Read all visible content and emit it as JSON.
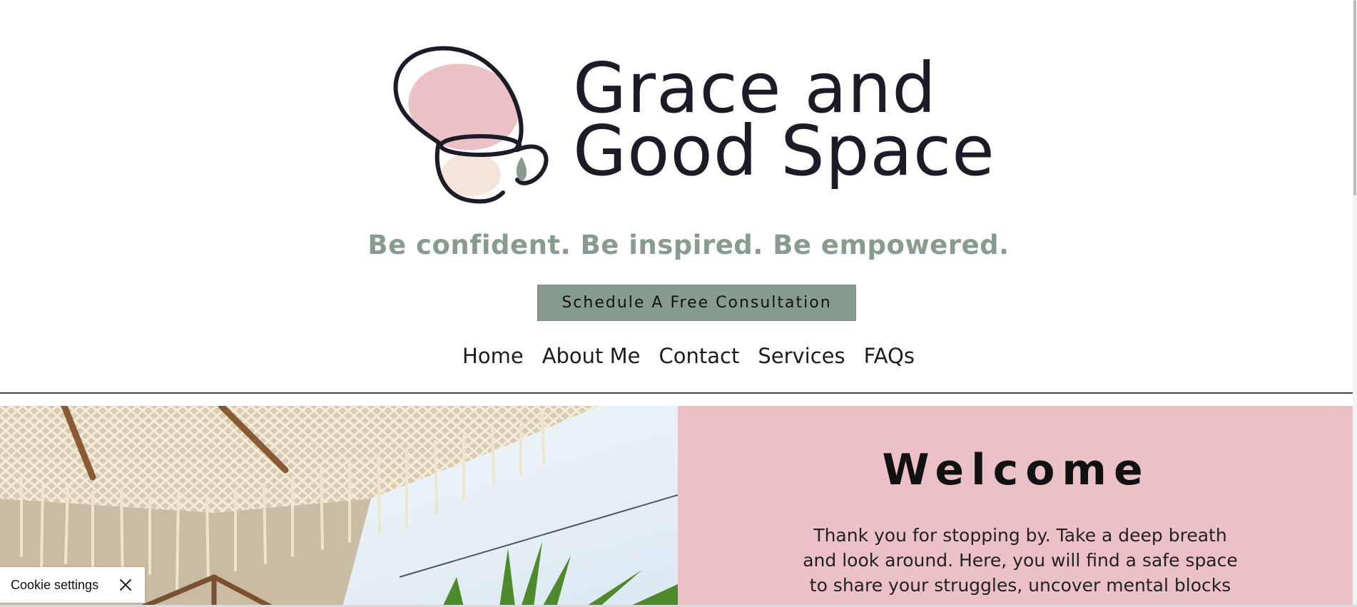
{
  "brand": {
    "name_line1": "Grace and",
    "name_line2": "Good Space",
    "logo_icon": "head-silhouette-logo-icon",
    "text_color": "#1e1b29",
    "pink": "#ebc1c7",
    "sage": "#879c8e"
  },
  "tagline": "Be confident. Be inspired. Be empowered.",
  "cta_label": "Schedule A Free Consultation",
  "nav": {
    "items": [
      {
        "label": "Home"
      },
      {
        "label": "About Me"
      },
      {
        "label": "Contact"
      },
      {
        "label": "Services"
      },
      {
        "label": "FAQs"
      }
    ]
  },
  "welcome": {
    "title": "Welcome",
    "body_lines": [
      "Thank you for stopping by. Take a deep breath",
      "and look around. Here, you will find a safe space",
      "to share your struggles, uncover mental blocks"
    ]
  },
  "cookie": {
    "label": "Cookie settings",
    "close_icon": "close-icon"
  }
}
